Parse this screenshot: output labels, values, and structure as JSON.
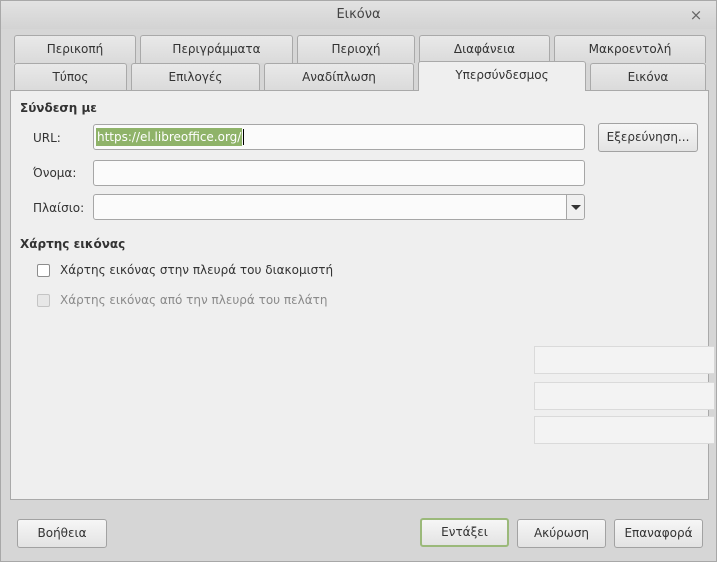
{
  "window": {
    "title": "Εικόνα"
  },
  "tabs_row1": [
    "Περικοπή",
    "Περιγράμματα",
    "Περιοχή",
    "Διαφάνεια",
    "Μακροεντολή"
  ],
  "tabs_row2": [
    "Τύπος",
    "Επιλογές",
    "Αναδίπλωση",
    "Υπερσύνδεσμος",
    "Εικόνα"
  ],
  "link_section": {
    "title": "Σύνδεση με",
    "url_label": "URL:",
    "url_value": "https://el.libreoffice.org/",
    "browse_button": "Εξερεύνηση...",
    "name_label": "Όνομα:",
    "name_value": "",
    "frame_label": "Πλαίσιο:",
    "frame_value": ""
  },
  "image_map_section": {
    "title": "Χάρτης εικόνας",
    "server_side": {
      "label": "Χάρτης εικόνας στην πλευρά του διακομιστή",
      "checked": false,
      "enabled": true
    },
    "client_side": {
      "label": "Χάρτης εικόνας από την πλευρά του πελάτη",
      "checked": false,
      "enabled": false
    }
  },
  "buttons": {
    "help": "Βοήθεια",
    "ok": "Εντάξει",
    "cancel": "Ακύρωση",
    "reset": "Επαναφορά"
  }
}
